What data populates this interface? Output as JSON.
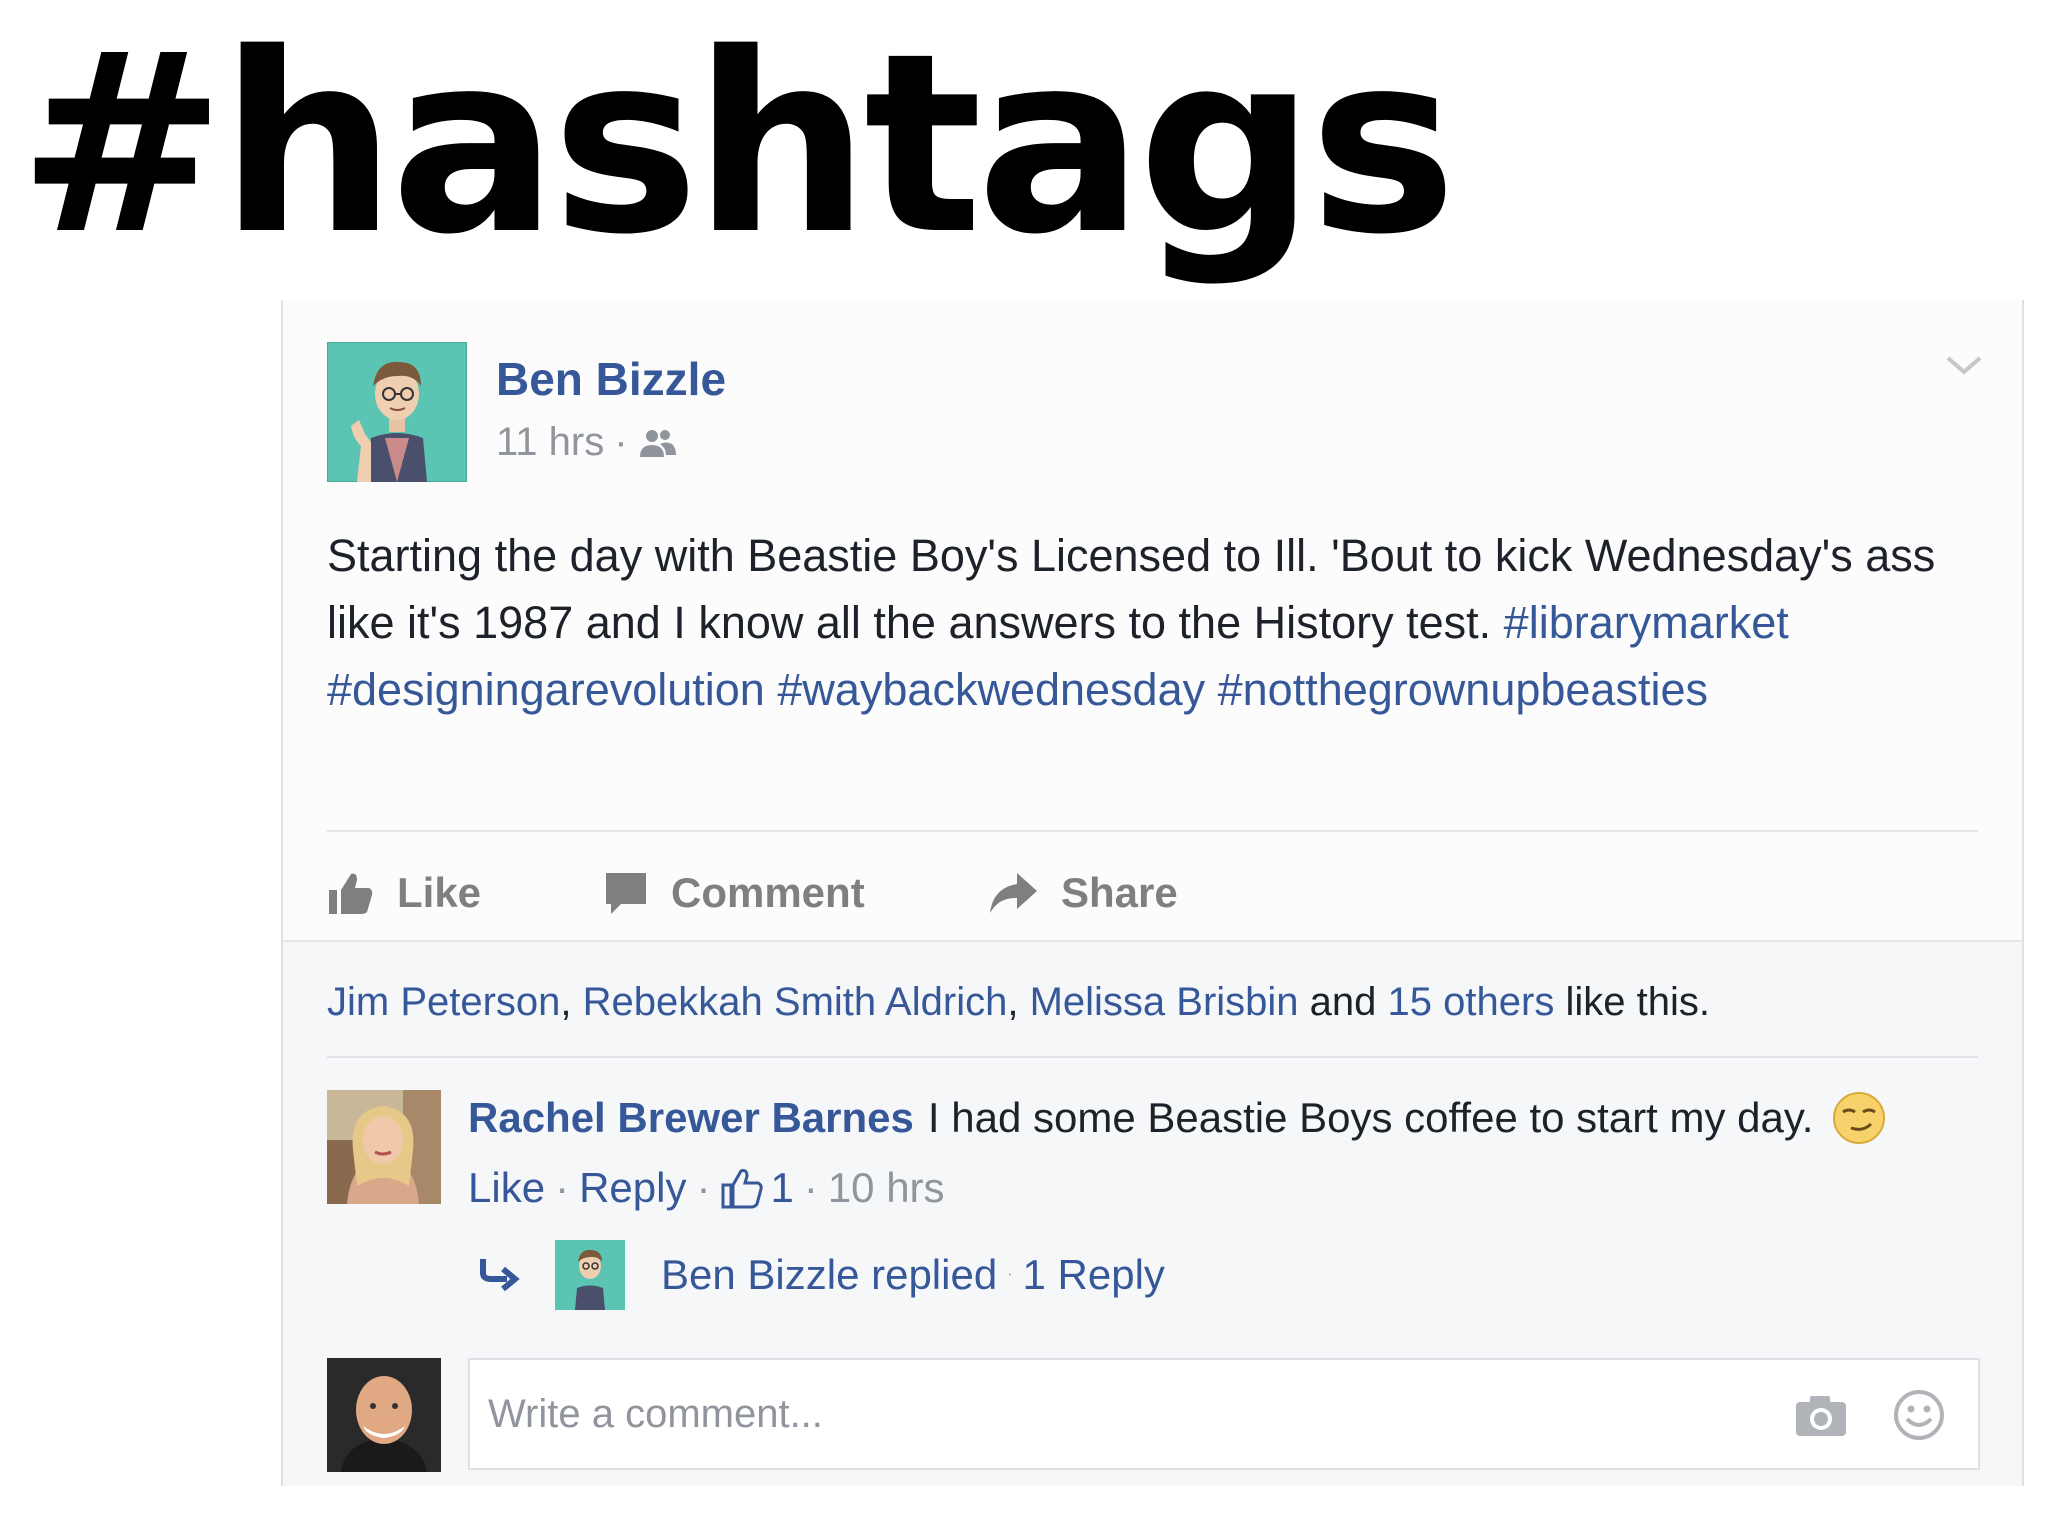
{
  "page": {
    "headline": "#hashtags"
  },
  "post": {
    "author": "Ben Bizzle",
    "time": "11 hrs",
    "meta_sep": "·",
    "text_1": "Starting the day with Beastie Boy's Licensed to Ill. 'Bout to kick Wednesday's ass like it's 1987 and I know all the answers to the History test.",
    "hashtags": [
      "#librarymarket",
      "#designingarevolution",
      "#waybackwednesday",
      "#notthegrownupbeasties"
    ],
    "actions": {
      "like": "Like",
      "comment": "Comment",
      "share": "Share"
    },
    "action_color": "#7f7f7f",
    "link_color": "#365899"
  },
  "likes": {
    "names": [
      "Jim Peterson",
      "Rebekkah Smith Aldrich",
      "Melissa Brisbin"
    ],
    "comma": ",",
    "and": "and",
    "others": "15 others",
    "suffix": "like this."
  },
  "comment": {
    "author": "Rachel Brewer Barnes",
    "text": "I had some Beastie Boys coffee to start my day.",
    "like": "Like",
    "reply": "Reply",
    "like_count": "1",
    "time": "10 hrs",
    "sep": "·"
  },
  "reply_summary": {
    "text": "Ben Bizzle replied",
    "sep": "·",
    "count": "1 Reply"
  },
  "composer": {
    "placeholder": "Write a comment..."
  },
  "icons": {
    "friends": "friends-icon",
    "chevron": "chevron-down-icon",
    "like": "thumbs-up-icon",
    "comment": "comment-bubble-icon",
    "share": "share-arrow-icon",
    "emoji": "smirk-emoji-icon",
    "reply_arrow": "reply-arrow-icon",
    "camera": "camera-icon",
    "smiley": "smiley-icon"
  }
}
